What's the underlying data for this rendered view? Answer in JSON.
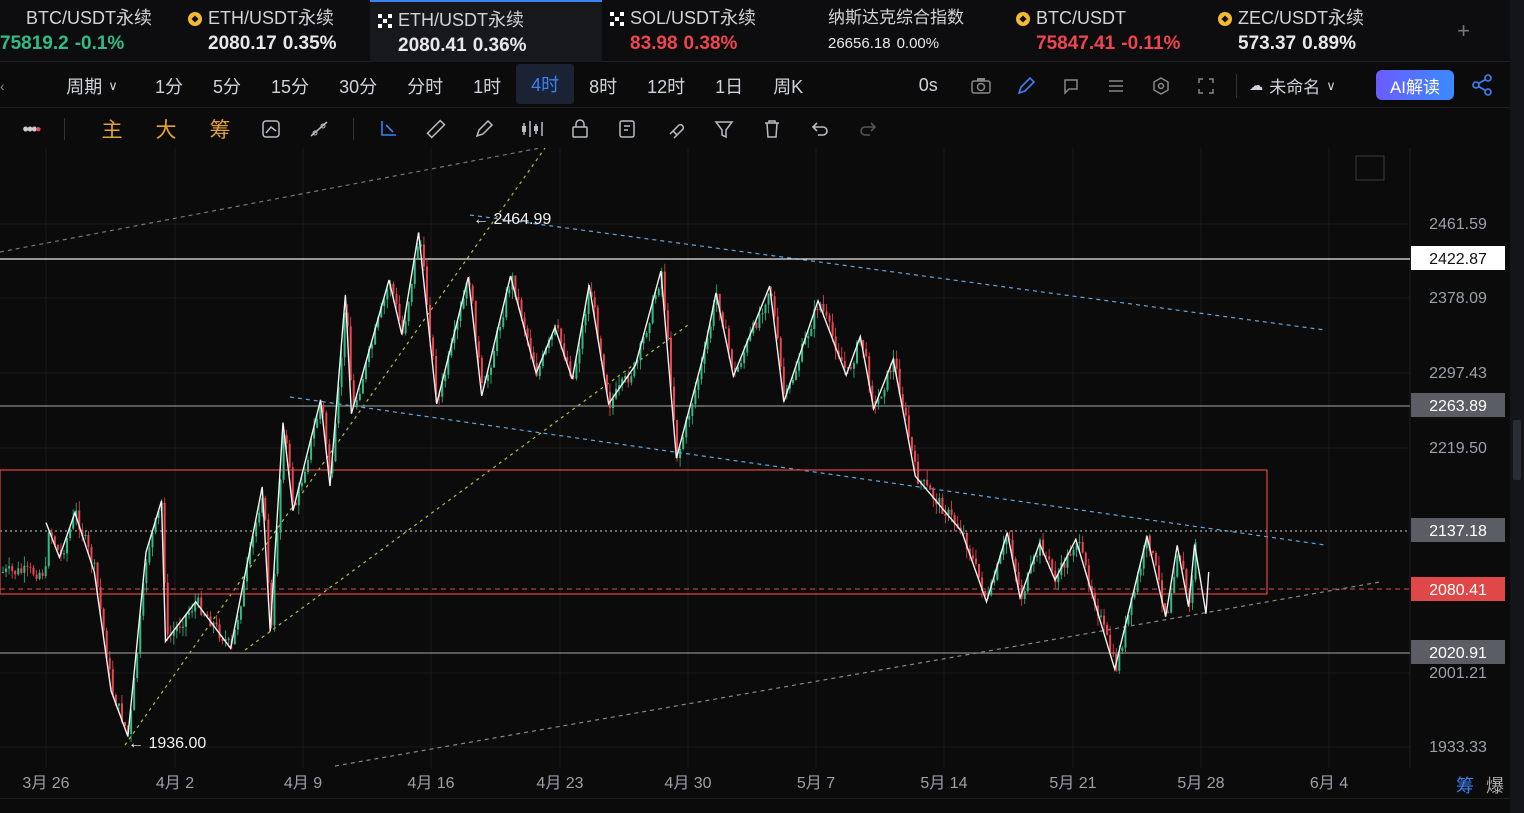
{
  "tabs": [
    {
      "name": "BTC/USDT永续",
      "price": "75819.2",
      "change": "-0.1%",
      "icon": "bitcoin-icon",
      "price_color": "up",
      "change_color": "up"
    },
    {
      "name": "ETH/USDT永续",
      "price": "2080.17",
      "change": "0.35%",
      "icon": "coin-icon",
      "price_color": "wt",
      "change_color": "wt"
    },
    {
      "name": "ETH/USDT永续",
      "price": "2080.41",
      "change": "0.36%",
      "icon": "okx-icon",
      "active": true,
      "price_color": "wt",
      "change_color": "wt"
    },
    {
      "name": "SOL/USDT永续",
      "price": "83.98",
      "change": "0.38%",
      "icon": "okx-icon",
      "price_color": "dn",
      "change_color": "dn"
    },
    {
      "name": "纳斯达克综合指数",
      "price": "26656.18",
      "change": "0.00%",
      "icon": "",
      "price_color": "wt",
      "change_color": "wt"
    },
    {
      "name": "BTC/USDT",
      "price": "75847.41",
      "change": "-0.11%",
      "icon": "coin-icon",
      "price_color": "dn",
      "change_color": "dn"
    },
    {
      "name": "ZEC/USDT永续",
      "price": "573.37",
      "change": "0.89%",
      "icon": "coin-icon",
      "price_color": "wt",
      "change_color": "wt"
    }
  ],
  "toolbar": {
    "period_label": "周期",
    "intervals": [
      "1分",
      "5分",
      "15分",
      "30分",
      "分时",
      "1时",
      "4时",
      "8时",
      "12时",
      "1日",
      "周K"
    ],
    "selected_interval": "4时",
    "countdown": "0s",
    "layout_name": "未命名",
    "ai_label": "AI解读"
  },
  "drawing_toolbar": {
    "indicator_labels": [
      "主",
      "大",
      "筹"
    ]
  },
  "chart_data": {
    "type": "candlestick",
    "symbol": "ETH/USDT永续",
    "interval": "4时",
    "y_ticks": [
      2461.59,
      2378.09,
      2297.43,
      2219.5,
      2001.21,
      1933.33
    ],
    "x_ticks": [
      "3月 26",
      "4月 2",
      "4月 9",
      "4月 16",
      "4月 23",
      "4月 30",
      "5月 7",
      "5月 14",
      "5月 21",
      "5月 28",
      "6月 4"
    ],
    "price_labels": [
      {
        "value": "2422.87",
        "style": "white"
      },
      {
        "value": "2263.89",
        "style": "gray"
      },
      {
        "value": "2137.18",
        "style": "gray"
      },
      {
        "value": "2080.41",
        "style": "red"
      },
      {
        "value": "2020.91",
        "style": "gray"
      }
    ],
    "annotations": [
      {
        "text": "← 2464.99",
        "kind": "high"
      },
      {
        "text": "← 1936.00",
        "kind": "low"
      }
    ],
    "zigzag": [
      [
        2172,
        2160
      ],
      [
        2192,
        2125
      ],
      [
        2215,
        2170
      ],
      [
        2244,
        2110
      ],
      [
        2269,
        1990
      ],
      [
        2294,
        1944
      ],
      [
        2321,
        2130
      ],
      [
        2344,
        2182
      ],
      [
        2350,
        2040
      ],
      [
        2395,
        2080
      ],
      [
        2447,
        2033
      ],
      [
        2494,
        2196
      ],
      [
        2506,
        2050
      ],
      [
        2525,
        2261
      ],
      [
        2540,
        2172
      ],
      [
        2581,
        2284
      ],
      [
        2595,
        2197
      ],
      [
        2618,
        2390
      ],
      [
        2627,
        2270
      ],
      [
        2683,
        2405
      ],
      [
        2702,
        2350
      ],
      [
        2727,
        2453
      ],
      [
        2754,
        2280
      ],
      [
        2801,
        2408
      ],
      [
        2821,
        2288
      ],
      [
        2864,
        2409
      ],
      [
        2902,
        2311
      ],
      [
        2930,
        2357
      ],
      [
        2956,
        2305
      ],
      [
        2981,
        2400
      ],
      [
        3010,
        2280
      ],
      [
        3050,
        2319
      ],
      [
        3088,
        2414
      ],
      [
        3111,
        2225
      ],
      [
        3151,
        2328
      ],
      [
        3170,
        2392
      ],
      [
        3196,
        2308
      ],
      [
        3250,
        2399
      ],
      [
        3271,
        2282
      ],
      [
        3322,
        2384
      ],
      [
        3364,
        2309
      ],
      [
        3385,
        2348
      ],
      [
        3405,
        2275
      ],
      [
        3434,
        2325
      ],
      [
        3467,
        2207
      ],
      [
        3536,
        2151
      ],
      [
        3573,
        2080
      ],
      [
        3604,
        2150
      ],
      [
        3623,
        2084
      ],
      [
        3652,
        2139
      ],
      [
        3675,
        2102
      ],
      [
        3706,
        2143
      ],
      [
        3764,
        2012
      ],
      [
        3812,
        2146
      ],
      [
        3840,
        2065
      ],
      [
        3857,
        2137
      ],
      [
        3874,
        2075
      ],
      [
        3883,
        2138
      ],
      [
        3900,
        2068
      ],
      [
        3904,
        2110
      ]
    ],
    "candles_note": "4h OHLC candles, approx 420 bars from 3月 23 to 5月 28"
  }
}
